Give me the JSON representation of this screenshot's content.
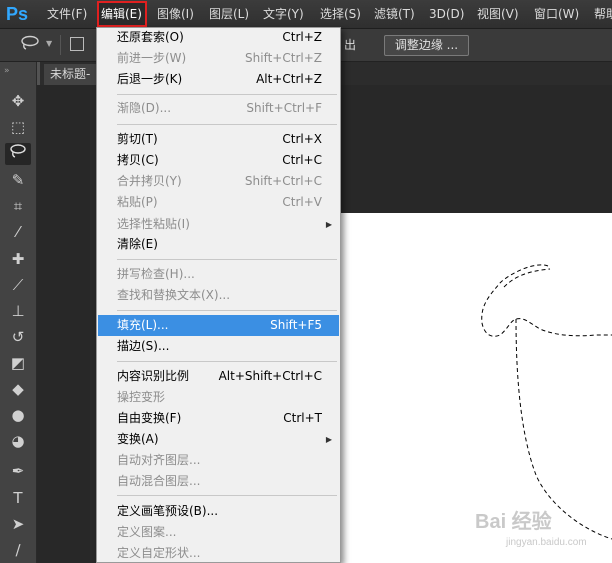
{
  "app": {
    "logo": "Ps"
  },
  "menubar": {
    "items": [
      {
        "label": "文件(F)"
      },
      {
        "label": "编辑(E)"
      },
      {
        "label": "图像(I)"
      },
      {
        "label": "图层(L)"
      },
      {
        "label": "文字(Y)"
      },
      {
        "label": "选择(S)"
      },
      {
        "label": "滤镜(T)"
      },
      {
        "label": "3D(D)"
      },
      {
        "label": "视图(V)"
      },
      {
        "label": "窗口(W)"
      },
      {
        "label": "帮助(H)"
      }
    ]
  },
  "options": {
    "partial_label": "出",
    "refine_edge_label": "调整边缘 ..."
  },
  "document": {
    "tab_title": "未标题-"
  },
  "edit_menu": {
    "items": [
      {
        "label": "还原套索(O)",
        "shortcut": "Ctrl+Z",
        "enabled": true
      },
      {
        "label": "前进一步(W)",
        "shortcut": "Shift+Ctrl+Z",
        "enabled": false
      },
      {
        "label": "后退一步(K)",
        "shortcut": "Alt+Ctrl+Z",
        "enabled": true
      },
      {
        "label": "渐隐(D)...",
        "shortcut": "Shift+Ctrl+F",
        "enabled": false
      },
      {
        "label": "剪切(T)",
        "shortcut": "Ctrl+X",
        "enabled": true
      },
      {
        "label": "拷贝(C)",
        "shortcut": "Ctrl+C",
        "enabled": true
      },
      {
        "label": "合并拷贝(Y)",
        "shortcut": "Shift+Ctrl+C",
        "enabled": false
      },
      {
        "label": "粘贴(P)",
        "shortcut": "Ctrl+V",
        "enabled": false
      },
      {
        "label": "选择性粘贴(I)",
        "shortcut": "",
        "enabled": false,
        "submenu": true
      },
      {
        "label": "清除(E)",
        "shortcut": "",
        "enabled": true
      },
      {
        "label": "拼写检查(H)...",
        "shortcut": "",
        "enabled": false
      },
      {
        "label": "查找和替换文本(X)...",
        "shortcut": "",
        "enabled": false
      },
      {
        "label": "填充(L)...",
        "shortcut": "Shift+F5",
        "enabled": true,
        "highlighted": true
      },
      {
        "label": "描边(S)...",
        "shortcut": "",
        "enabled": true
      },
      {
        "label": "内容识别比例",
        "shortcut": "Alt+Shift+Ctrl+C",
        "enabled": true
      },
      {
        "label": "操控变形",
        "shortcut": "",
        "enabled": false
      },
      {
        "label": "自由变换(F)",
        "shortcut": "Ctrl+T",
        "enabled": true
      },
      {
        "label": "变换(A)",
        "shortcut": "",
        "enabled": true,
        "submenu": true
      },
      {
        "label": "自动对齐图层...",
        "shortcut": "",
        "enabled": false
      },
      {
        "label": "自动混合图层...",
        "shortcut": "",
        "enabled": false
      },
      {
        "label": "定义画笔预设(B)...",
        "shortcut": "",
        "enabled": true
      },
      {
        "label": "定义图案...",
        "shortcut": "",
        "enabled": false
      },
      {
        "label": "定义自定形状...",
        "shortcut": "",
        "enabled": false
      }
    ]
  },
  "watermark": {
    "main": "Bai 经验",
    "sub": "jingyan.baidu.com"
  },
  "colors": {
    "highlight": "#3b8fe3",
    "menu_outline": "#e02020",
    "ps_blue": "#31a8ff"
  },
  "icons": [
    "lasso-icon",
    "move-icon",
    "marquee-icon",
    "quick-select-icon",
    "crop-icon",
    "eyedropper-icon",
    "healing-icon",
    "brush-icon",
    "stamp-icon",
    "history-brush-icon",
    "eraser-icon",
    "gradient-icon",
    "blur-icon",
    "dodge-icon",
    "pen-icon",
    "type-icon",
    "path-select-icon",
    "line-icon"
  ]
}
